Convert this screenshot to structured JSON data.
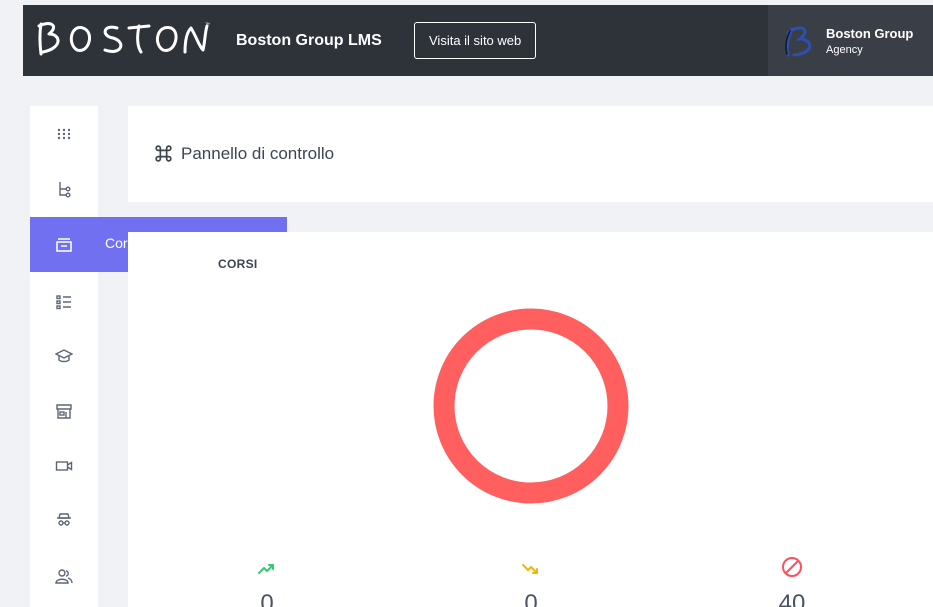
{
  "header": {
    "logo_text": "BOSTON",
    "app_title": "Boston Group LMS",
    "site_button_label": "Visita il sito web",
    "user": {
      "name": "Boston Group",
      "role": "Agency"
    }
  },
  "sidebar": {
    "items": [
      {
        "icon": "apps-grid-icon"
      },
      {
        "icon": "hierarchy-icon"
      },
      {
        "icon": "courses-icon",
        "label": "Corsi"
      },
      {
        "icon": "list-icon"
      },
      {
        "icon": "graduation-cap-icon"
      },
      {
        "icon": "store-icon"
      },
      {
        "icon": "video-camera-icon"
      },
      {
        "icon": "incognito-icon"
      },
      {
        "icon": "users-icon"
      }
    ],
    "flyout": {
      "label": "Corsi"
    }
  },
  "main": {
    "page_title": "Pannello di controllo",
    "section_title": "CORSI",
    "ring_color": "#ff5f5f",
    "stats": [
      {
        "icon": "trending-up-icon",
        "color": "#2ecc71",
        "value": "0"
      },
      {
        "icon": "trending-down-icon",
        "color": "#f5b400",
        "value": "0"
      },
      {
        "icon": "block-icon",
        "color": "#ff4f5e",
        "value": "40"
      }
    ]
  },
  "colors": {
    "topbar": "#2e3239",
    "accent": "#7070f0",
    "background": "#f1f2f6"
  }
}
